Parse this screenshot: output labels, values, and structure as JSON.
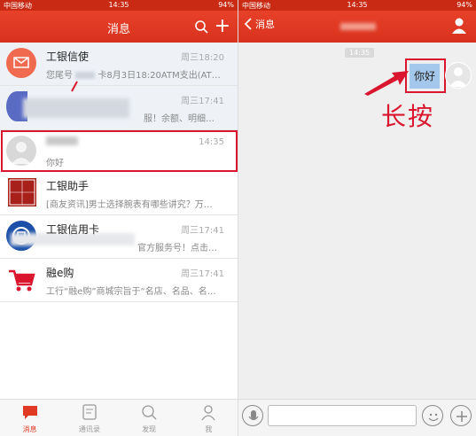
{
  "status_bar": {
    "carrier": "中国移动",
    "time": "14:35",
    "battery": "94%"
  },
  "left": {
    "title": "消息",
    "chats": [
      {
        "name": "工银信使",
        "time": "周三18:20",
        "preview": "您尾号",
        "preview_tail": "卡8月3日18:20ATM支出(AT…"
      },
      {
        "name": "",
        "time": "周三17:41",
        "preview": "服！余额、明细…"
      },
      {
        "name": "",
        "time": "14:35",
        "preview": "你好"
      },
      {
        "name": "工银助手",
        "time": "",
        "preview": "[商友资讯]男士选择腕表有哪些讲究？万…"
      },
      {
        "name": "工银信用卡",
        "time": "周三17:41",
        "preview": "官方服务号！点击…"
      },
      {
        "name": "融e购",
        "time": "周三17:41",
        "preview": "工行“融e购”商城宗旨于“名店、名品、名…"
      }
    ],
    "tabs": [
      {
        "label": "消息"
      },
      {
        "label": "通讯录"
      },
      {
        "label": "发现"
      },
      {
        "label": "我"
      }
    ]
  },
  "right": {
    "back_label": "消息",
    "timestamp": "14:35",
    "bubble_text": "你好",
    "annotation": "长按"
  },
  "colors": {
    "brand_red": "#e03a24",
    "highlight": "#d9162e",
    "bubble": "#a4c8ec"
  }
}
